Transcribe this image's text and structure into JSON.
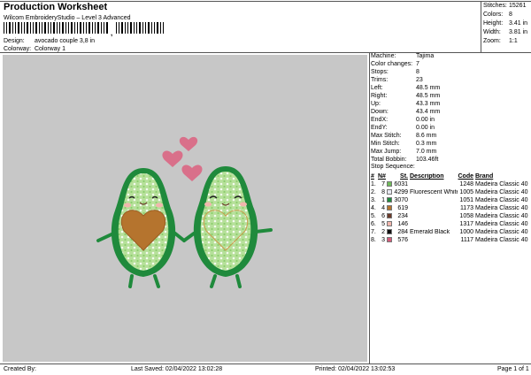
{
  "header": {
    "title": "Production Worksheet",
    "subtitle": "Wilcom EmbroideryStudio – Level 3 Advanced",
    "barcode_separator": ","
  },
  "meta": {
    "design_label": "Design:",
    "design_value": "avocado couple 3,8 in",
    "colorway_label": "Colorway:",
    "colorway_value": "Colorway 1"
  },
  "stats": [
    {
      "label": "Stitches:",
      "value": "15261"
    },
    {
      "label": "Colors:",
      "value": "8"
    },
    {
      "label": "Height:",
      "value": "3.41 in"
    },
    {
      "label": "Width:",
      "value": "3.81 in"
    },
    {
      "label": "Zoom:",
      "value": "1:1"
    }
  ],
  "info": [
    {
      "label": "Machine:",
      "value": "Tajima"
    },
    {
      "label": "Color changes:",
      "value": "7"
    },
    {
      "label": "Stops:",
      "value": "8"
    },
    {
      "label": "Trims:",
      "value": "23"
    },
    {
      "label": "Left:",
      "value": "48.5 mm"
    },
    {
      "label": "Right:",
      "value": "48.5 mm"
    },
    {
      "label": "Up:",
      "value": "43.3 mm"
    },
    {
      "label": "Down:",
      "value": "43.4 mm"
    },
    {
      "label": "EndX:",
      "value": "0.00 in"
    },
    {
      "label": "EndY:",
      "value": "0.00 in"
    },
    {
      "label": "Max Stitch:",
      "value": "8.6 mm"
    },
    {
      "label": "Min Stitch:",
      "value": "0.3 mm"
    },
    {
      "label": "Max Jump:",
      "value": "7.0 mm"
    },
    {
      "label": "Total Bobbin:",
      "value": "103.46ft"
    }
  ],
  "stop_sequence": {
    "title": "Stop Sequence:",
    "headers": {
      "idx": "#",
      "n": "N#",
      "st": "St.",
      "desc": "Description",
      "code": "Code",
      "brand": "Brand"
    },
    "rows": [
      {
        "idx": "1.",
        "n": "7",
        "color": "#6fbb5a",
        "st": "6031",
        "desc": "",
        "code": "1248",
        "brand": "Madeira Classic 40"
      },
      {
        "idx": "2.",
        "n": "8",
        "color": "#e9e9f2",
        "st": "4299",
        "desc": "Fluorescent White",
        "code": "1005",
        "brand": "Madeira Classic 40"
      },
      {
        "idx": "3.",
        "n": "1",
        "color": "#1f8a3c",
        "st": "3070",
        "desc": "",
        "code": "1051",
        "brand": "Madeira Classic 40"
      },
      {
        "idx": "4.",
        "n": "4",
        "color": "#b5742e",
        "st": "619",
        "desc": "",
        "code": "1173",
        "brand": "Madeira Classic 40"
      },
      {
        "idx": "5.",
        "n": "6",
        "color": "#6b3a2a",
        "st": "234",
        "desc": "",
        "code": "1058",
        "brand": "Madeira Classic 40"
      },
      {
        "idx": "6.",
        "n": "5",
        "color": "#f2b6ad",
        "st": "146",
        "desc": "",
        "code": "1317",
        "brand": "Madeira Classic 40"
      },
      {
        "idx": "7.",
        "n": "2",
        "color": "#111111",
        "st": "284",
        "desc": "Emerald Black",
        "code": "1000",
        "brand": "Madeira Classic 40"
      },
      {
        "idx": "8.",
        "n": "3",
        "color": "#d45b7a",
        "st": "576",
        "desc": "",
        "code": "1117",
        "brand": "Madeira Classic 40"
      }
    ]
  },
  "footer": {
    "created_by": "Created By:",
    "last_saved": "Last Saved: 02/04/2022 13:02:28",
    "printed": "Printed: 02/04/2022 13:02:53",
    "page": "Page 1 of 1"
  },
  "colors": {
    "canvas_bg": "#c7c7c7",
    "avocado_outer": "#1f8a3c",
    "avocado_flesh": "#b6e09a",
    "pit": "#b5742e",
    "heart_pink": "#d9708a",
    "cheek": "#f2b6ad"
  }
}
